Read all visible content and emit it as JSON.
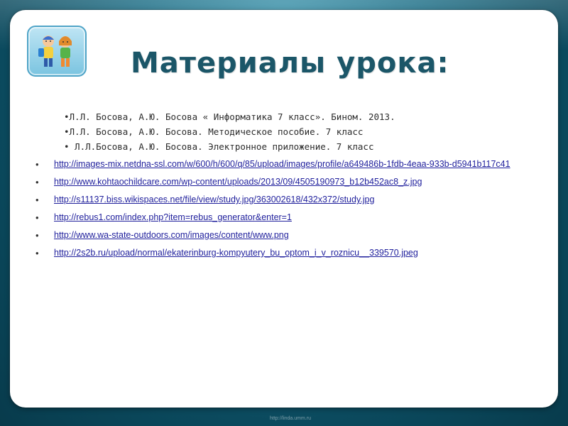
{
  "slide": {
    "title": "Материалы урока:",
    "references": [
      "•Л.Л. Босова, А.Ю. Босова « Информатика 7 класс». Бином. 2013.",
      "•Л.Л. Босова, А.Ю. Босова. Методическое пособие. 7 класс",
      "• Л.Л.Босова, А.Ю. Босова. Электронное приложение. 7 класс"
    ],
    "links": [
      "http://images-mix.netdna-ssl.com/w/600/h/600/q/85/upload/images/profile/a649486b-1fdb-4eaa-933b-d5941b117c41",
      "http://www.kohtaochildcare.com/wp-content/uploads/2013/09/4505190973_b12b452ac8_z.jpg",
      "http://s11137.biss.wikispaces.net/file/view/study.jpg/363002618/432x372/study.jpg",
      "http://rebus1.com/index.php?item=rebus_generator&enter=1",
      "http://www.wa-state-outdoors.com/images/content/www.png",
      "http://2s2b.ru/upload/normal/ekaterinburg-kompyutery_bu_optom_i_v_roznicu__339570.jpeg"
    ],
    "bullet_char": "•",
    "footer_url": "http://linda.umm.ru",
    "colors": {
      "title": "#1b5668",
      "link": "#1f1f9c",
      "frame": "#0e5368"
    }
  }
}
